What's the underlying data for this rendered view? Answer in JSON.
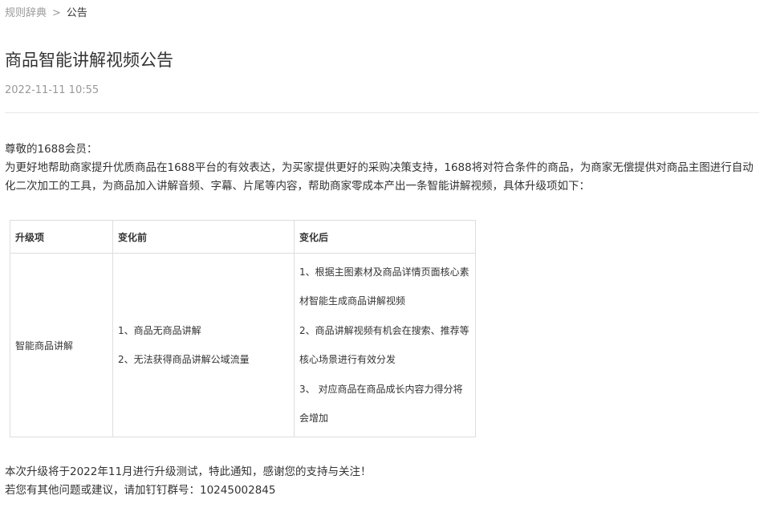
{
  "breadcrumb": {
    "parent": "规则辞典",
    "separator": ">",
    "current": "公告"
  },
  "article": {
    "title": "商品智能讲解视频公告",
    "date": "2022-11-11 10:55",
    "greeting": "尊敬的1688会员：",
    "intro": "为更好地帮助商家提升优质商品在1688平台的有效表达，为买家提供更好的采购决策支持，1688将对符合条件的商品，为商家无偿提供对商品主图进行自动化二次加工的工具，为商品加入讲解音频、字幕、片尾等内容，帮助商家零成本产出一条智能讲解视频，具体升级项如下："
  },
  "table": {
    "headers": [
      "升级项",
      "变化前",
      "变化后"
    ],
    "row": {
      "item": "智能商品讲解",
      "before": [
        "1、商品无商品讲解",
        "2、无法获得商品讲解公域流量"
      ],
      "after": [
        "1、根据主图素材及商品详情页面核心素",
        "材智能生成商品讲解视频",
        "2、商品讲解视频有机会在搜索、推荐等",
        "核心场景进行有效分发",
        "3、 对应商品在商品成长内容力得分将",
        "会增加"
      ]
    }
  },
  "footer": {
    "line1": "本次升级将于2022年11月进行升级测试，特此通知，感谢您的支持与关注！",
    "line2": "若您有其他问题或建议，请加钉钉群号：10245002845"
  }
}
